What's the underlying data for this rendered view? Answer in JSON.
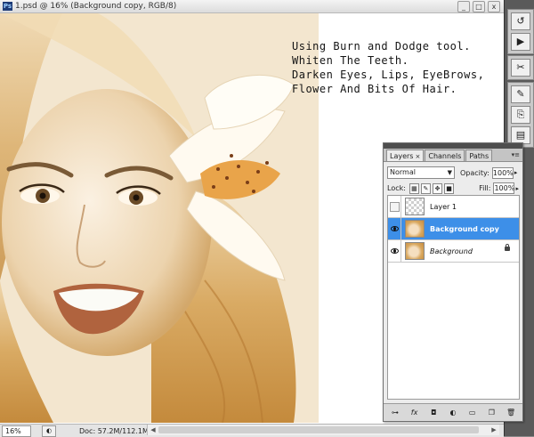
{
  "window": {
    "title": "1.psd @ 16% (Background copy, RGB/8)",
    "app_icon": "Ps",
    "minimize": "_",
    "maximize": "□",
    "close": "x"
  },
  "note_lines": [
    "Using Burn and Dodge tool.",
    "Whiten The Teeth.",
    "Darken Eyes, Lips, EyeBrows,",
    "Flower And Bits Of Hair."
  ],
  "status": {
    "zoom": "16%",
    "doc": "Doc: 57.2M/112.1M",
    "arrow": "▶"
  },
  "layers_panel": {
    "tabs": [
      {
        "label": "Layers",
        "active": true,
        "close": "×"
      },
      {
        "label": "Channels",
        "active": false
      },
      {
        "label": "Paths",
        "active": false
      }
    ],
    "menu_icon": "▾≡",
    "blend_mode": "Normal",
    "opacity_label": "Opacity:",
    "opacity_value": "100%",
    "lock_label": "Lock:",
    "fill_label": "Fill:",
    "fill_value": "100%",
    "layers": [
      {
        "name": "Layer 1",
        "visible": false,
        "selected": false,
        "italic": false
      },
      {
        "name": "Background copy",
        "visible": true,
        "selected": true,
        "italic": false
      },
      {
        "name": "Background",
        "visible": true,
        "selected": false,
        "italic": true,
        "locked": true
      }
    ],
    "footer_icons": [
      "link-icon",
      "fx-icon",
      "mask-icon",
      "adjustment-icon",
      "group-icon",
      "new-layer-icon",
      "trash-icon"
    ]
  },
  "dock_icons": [
    "history-icon",
    "actions-icon",
    "tools-icon",
    "brush-icon",
    "clone-icon",
    "info-icon"
  ],
  "colors": {
    "selection": "#3d8fe8",
    "sepia_light": "#f7efe2",
    "sepia_dark": "#c58b3e"
  }
}
